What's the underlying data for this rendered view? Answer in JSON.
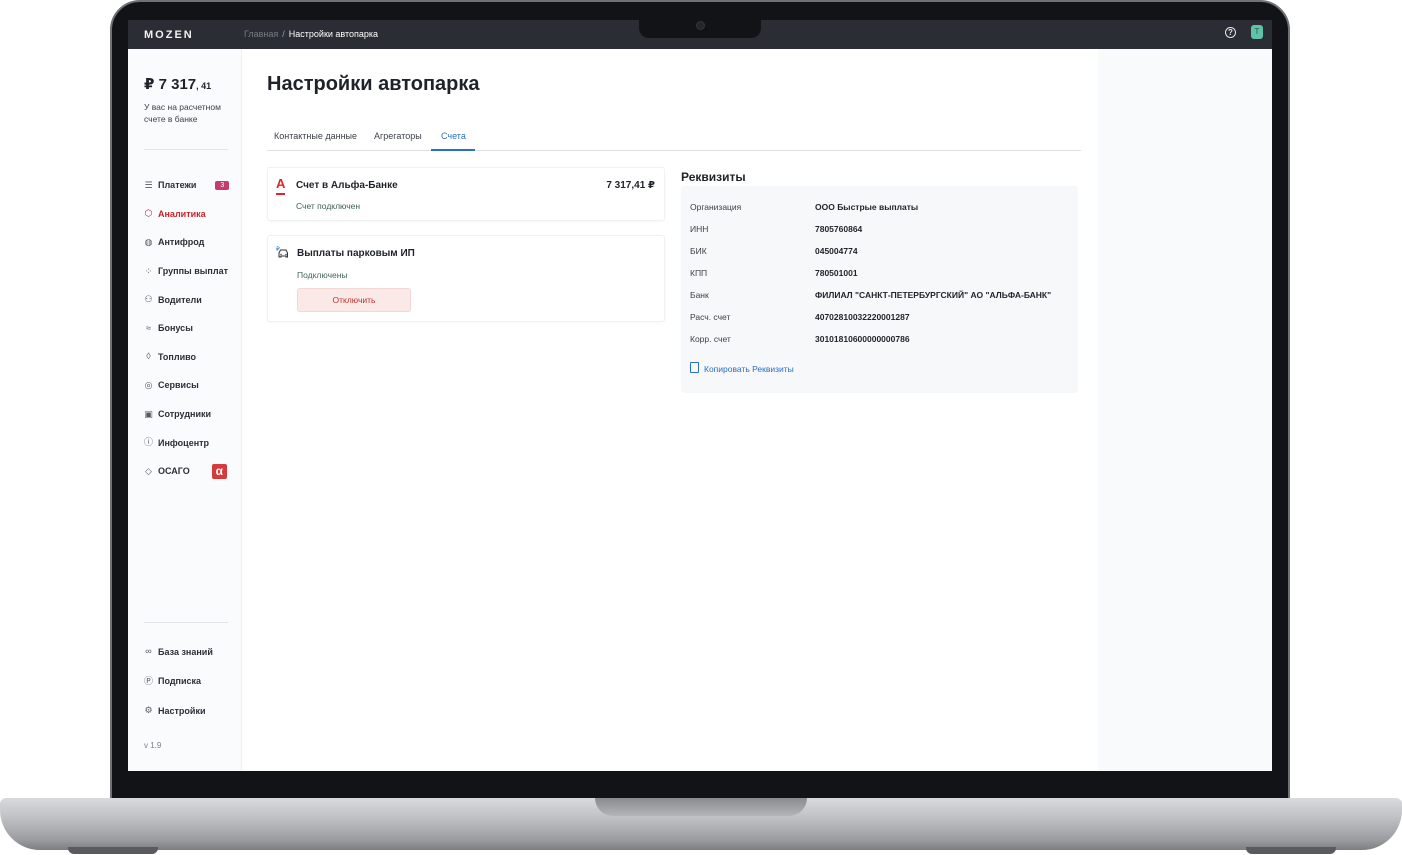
{
  "app": {
    "logo": "MOZEN"
  },
  "breadcrumb": {
    "home": "Главная",
    "separator": "/",
    "current": "Настройки автопарка"
  },
  "topbar": {
    "help_icon": "?",
    "avatar_letter": "T"
  },
  "sidebar": {
    "balance_main": "₽ 7 317",
    "balance_cents": ", 41",
    "balance_note": "У вас на расчетном счете в банке",
    "items": [
      {
        "label": "Платежи",
        "icon": "list-icon",
        "glyph": "☰",
        "badge": "3"
      },
      {
        "label": "Аналитика",
        "icon": "box-icon",
        "glyph": "⬡",
        "active": true
      },
      {
        "label": "Антифрод",
        "icon": "shield-scan-icon",
        "glyph": "◍"
      },
      {
        "label": "Группы выплат",
        "icon": "grid-icon",
        "glyph": "⁘"
      },
      {
        "label": "Водители",
        "icon": "users-icon",
        "glyph": "⚇"
      },
      {
        "label": "Бонусы",
        "icon": "waves-icon",
        "glyph": "≈"
      },
      {
        "label": "Топливо",
        "icon": "drop-icon",
        "glyph": "◊"
      },
      {
        "label": "Сервисы",
        "icon": "target-icon",
        "glyph": "◎"
      },
      {
        "label": "Сотрудники",
        "icon": "id-card-icon",
        "glyph": "▣"
      },
      {
        "label": "Инфоцентр",
        "icon": "info-icon",
        "glyph": "ⓘ"
      },
      {
        "label": "ОСАГО",
        "icon": "shield-icon",
        "glyph": "◇",
        "logo": "α"
      }
    ],
    "bottom_items": [
      {
        "label": "База знаний",
        "icon": "glasses-icon",
        "glyph": "∞"
      },
      {
        "label": "Подписка",
        "icon": "p-circle-icon",
        "glyph": "Ⓟ"
      },
      {
        "label": "Настройки",
        "icon": "gear-icon",
        "glyph": "⚙"
      }
    ],
    "version": "v 1.9"
  },
  "main": {
    "title": "Настройки автопарка",
    "tabs": [
      "Контактные данные",
      "Агрегаторы",
      "Счета"
    ],
    "active_tab": "Счета",
    "bank_card": {
      "title": "Счет в Альфа-Банке",
      "amount": "7 317,41 ₽",
      "status": "Счет подключен",
      "logo": "A"
    },
    "park_card": {
      "title": "Выплаты парковым ИП",
      "status": "Подключены",
      "button": "Отключить"
    },
    "requisites": {
      "title": "Реквизиты",
      "rows": [
        {
          "key": "Организация",
          "value": "ООО Быстрые выплаты"
        },
        {
          "key": "ИНН",
          "value": "7805760864"
        },
        {
          "key": "БИК",
          "value": "045004774"
        },
        {
          "key": "КПП",
          "value": "780501001"
        },
        {
          "key": "Банк",
          "value": "ФИЛИАЛ \"САНКТ-ПЕТЕРБУРГСКИЙ\" АО \"АЛЬФА-БАНК\""
        },
        {
          "key": "Расч. счет",
          "value": "40702810032220001287"
        },
        {
          "key": "Корр. счет",
          "value": "30101810600000000786"
        }
      ],
      "copy_label": "Копировать Реквизиты"
    }
  },
  "colors": {
    "accent": "#2a6fc2",
    "active_nav": "#c8232c",
    "alfa_red": "#e0242c",
    "badge": "#c43d68",
    "topbar": "#2a2d34"
  }
}
